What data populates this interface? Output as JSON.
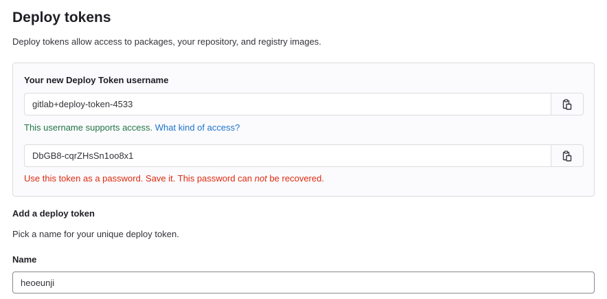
{
  "header": {
    "title": "Deploy tokens",
    "description": "Deploy tokens allow access to packages, your repository, and registry images."
  },
  "new_token": {
    "username_label": "Your new Deploy Token username",
    "username_value": "gitlab+deploy-token-4533",
    "username_help": "This username supports access.",
    "username_help_link": "What kind of access?",
    "token_value": "DbGB8-cqrZHsSn1oo8x1",
    "token_help_prefix": "Use this token as a password. Save it. This password can ",
    "token_help_emphasis": "not",
    "token_help_suffix": " be recovered."
  },
  "add_form": {
    "title": "Add a deploy token",
    "description": "Pick a name for your unique deploy token.",
    "name_label": "Name",
    "name_value": "heoeunji"
  },
  "icons": {
    "copy": "clipboard-icon"
  },
  "colors": {
    "success": "#217645",
    "link": "#1f75cb",
    "danger": "#dd2b0e"
  }
}
